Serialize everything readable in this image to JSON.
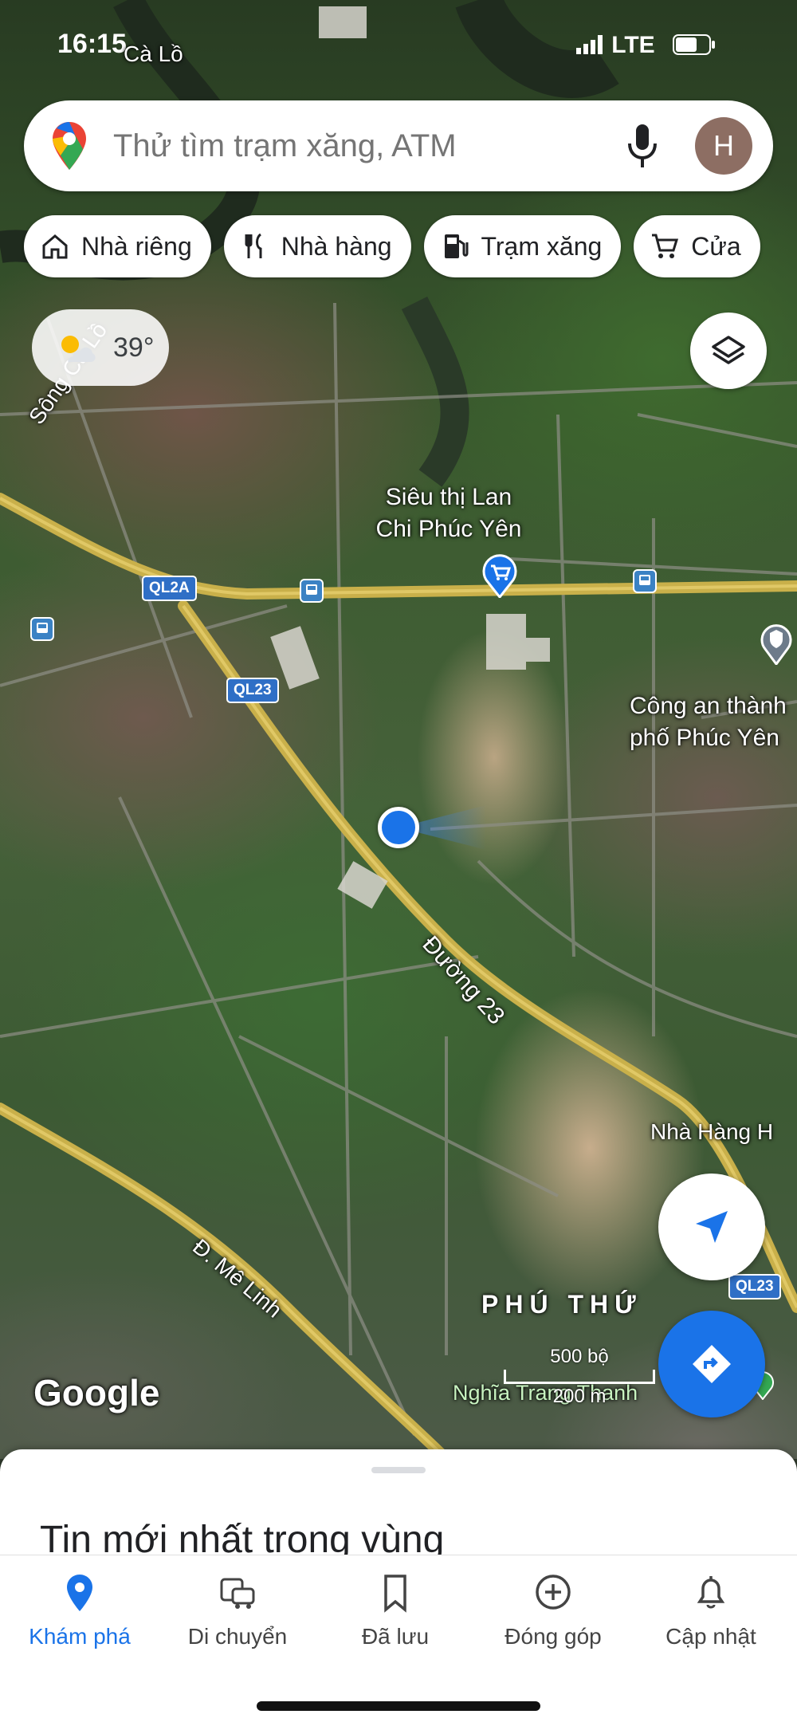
{
  "status_bar": {
    "time": "16:15",
    "network": "LTE"
  },
  "search": {
    "placeholder": "Thử tìm trạm xăng, ATM",
    "avatar_letter": "H"
  },
  "chips": [
    {
      "label": "Nhà riêng",
      "icon": "home-icon"
    },
    {
      "label": "Nhà hàng",
      "icon": "restaurant-icon"
    },
    {
      "label": "Trạm xăng",
      "icon": "gas-station-icon"
    },
    {
      "label": "Cửa",
      "icon": "cart-icon"
    }
  ],
  "weather": {
    "temperature": "39°",
    "icon": "partly-sunny-icon"
  },
  "map": {
    "labels": {
      "river": "Sông Cà Lồ",
      "river_top": "Cà Lồ",
      "supermarket": "Siêu thị Lan Chi Phúc Yên",
      "police": "Công an thành phố Phúc Yên",
      "road_23": "Đường 23",
      "restaurant": "Nhà Hàng H",
      "me_linh": "Đ. Mê Linh",
      "area": "PHÚ THỨ",
      "cemetery": "Nghĩa Trang Thanh"
    },
    "shields": {
      "ql2a": "QL2A",
      "ql23_a": "QL23",
      "ql23_b": "QL23"
    },
    "scale": {
      "top": "500 bộ",
      "bottom": "200 m"
    },
    "logo": "Google",
    "colors": {
      "accent": "#1a73e8",
      "shield": "#2f6fc6",
      "road": "#c9b04a"
    }
  },
  "sheet": {
    "title": "Tin mới nhất trong vùng"
  },
  "nav": [
    {
      "label": "Khám phá",
      "icon": "explore-pin-icon",
      "active": true
    },
    {
      "label": "Di chuyển",
      "icon": "commute-icon",
      "active": false
    },
    {
      "label": "Đã lưu",
      "icon": "bookmark-icon",
      "active": false
    },
    {
      "label": "Đóng góp",
      "icon": "add-circle-icon",
      "active": false
    },
    {
      "label": "Cập nhật",
      "icon": "bell-icon",
      "active": false
    }
  ]
}
